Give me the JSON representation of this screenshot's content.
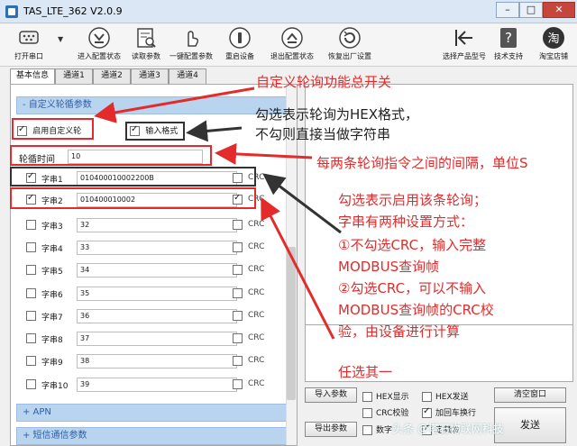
{
  "window": {
    "title": "TAS_LTE_362 V2.0.9"
  },
  "toolbar": {
    "items": [
      {
        "label": "打开串口",
        "icon": "serial-port-icon"
      },
      {
        "label": "进入配置状态",
        "icon": "enter-config-icon"
      },
      {
        "label": "读取参数",
        "icon": "read-params-icon"
      },
      {
        "label": "一键配置参数",
        "icon": "one-click-config-icon"
      },
      {
        "label": "重启设备",
        "icon": "power-icon"
      },
      {
        "label": "退出配置状态",
        "icon": "exit-config-icon"
      },
      {
        "label": "恢复出厂设置",
        "icon": "factory-reset-icon"
      },
      {
        "label": "选择产品型号",
        "icon": "back-arrow-icon"
      },
      {
        "label": "技术支持",
        "icon": "help-icon"
      },
      {
        "label": "淘宝店铺",
        "icon": "taobao-icon",
        "badge": "淘"
      }
    ]
  },
  "tabs": [
    {
      "label": "基本信息",
      "active": true
    },
    {
      "label": "通道1"
    },
    {
      "label": "通道2"
    },
    {
      "label": "通道3"
    },
    {
      "label": "通道4"
    }
  ],
  "section": {
    "title": "- 自定义轮循参数",
    "enable_custom_label": "启用自定义轮",
    "hex_format_label": "输入格式",
    "interval_label": "轮循时间",
    "interval_value": "10",
    "rows": [
      {
        "name": "字串1",
        "value": "010400010002200B",
        "checked": true,
        "crc": false
      },
      {
        "name": "字串2",
        "value": "010400010002",
        "checked": true,
        "crc": true
      },
      {
        "name": "字串3",
        "value": "32",
        "checked": false,
        "crc": false
      },
      {
        "name": "字串4",
        "value": "33",
        "checked": false,
        "crc": false
      },
      {
        "name": "字串5",
        "value": "34",
        "checked": false,
        "crc": false
      },
      {
        "name": "字串6",
        "value": "35",
        "checked": false,
        "crc": false
      },
      {
        "name": "字串7",
        "value": "36",
        "checked": false,
        "crc": false
      },
      {
        "name": "字串8",
        "value": "37",
        "checked": false,
        "crc": false
      },
      {
        "name": "字串9",
        "value": "38",
        "checked": false,
        "crc": false
      },
      {
        "name": "字串10",
        "value": "39",
        "checked": false,
        "crc": false
      }
    ],
    "crc_label": "CRC",
    "apn_title": "+ APN",
    "sms_title": "+ 短信通信参数"
  },
  "bottom": {
    "import_button": "导入参数",
    "export_button": "导出参数",
    "clear_button": "清空窗口",
    "send_button": "发送",
    "hex_display": "HEX显示",
    "hex_send": "HEX发送",
    "crc_check": "CRC校验",
    "add_newline": "加回车换行",
    "timestamp_partial": "数字",
    "fixed_partial": "定频发"
  },
  "annotations": {
    "master_switch": "自定义轮询功能总开关",
    "hex_line1": "勾选表示轮询为HEX格式，",
    "hex_line2": "不勾则直接当做字符串",
    "interval_note": "每两条轮询指令之间的间隔，单位S",
    "enable_note1": "勾选表示启用该条轮询；",
    "enable_note2": "字串有两种设置方式：",
    "method1_line1": "①不勾选CRC，输入完整",
    "method1_line2": "MODBUS查询帧",
    "method2_line1": "②勾选CRC，可以不输入",
    "method2_line2": "MODBUS查询帧的CRC校",
    "method2_line3": "验，由设备进行计算",
    "choose_one": "任选其一"
  },
  "watermark": "头条 @塔石物联网科技"
}
